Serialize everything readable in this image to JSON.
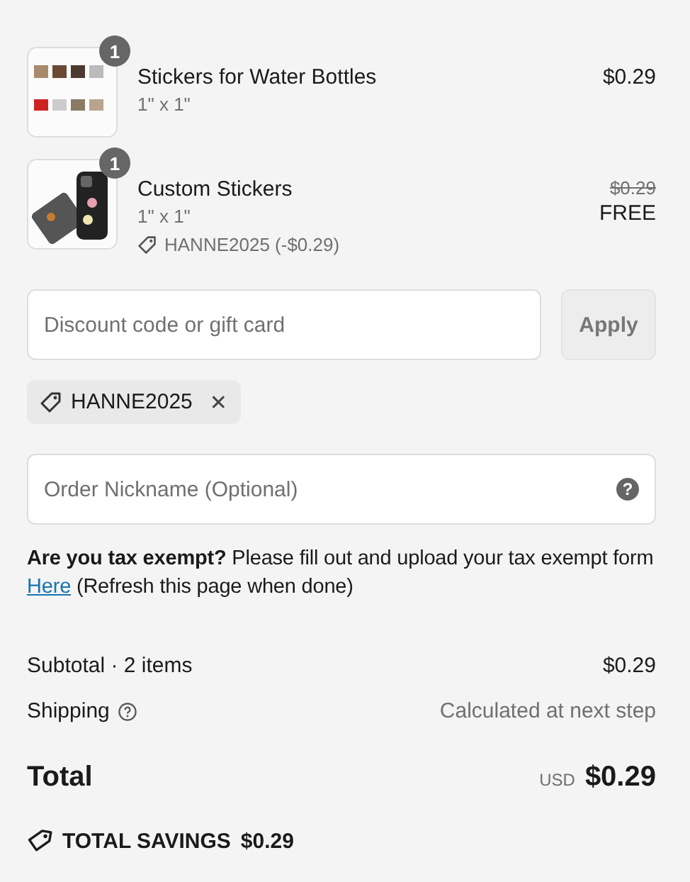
{
  "line_items": [
    {
      "quantity": "1",
      "name": "Stickers for Water Bottles",
      "variant": "1\" x 1\"",
      "price": "$0.29"
    },
    {
      "quantity": "1",
      "name": "Custom Stickers",
      "variant": "1\" x 1\"",
      "discount": "HANNE2025 (-$0.29)",
      "original_price": "$0.29",
      "price": "FREE"
    }
  ],
  "discount_field": {
    "placeholder": "Discount code or gift card"
  },
  "apply_button": {
    "label": "Apply",
    "disabled": true
  },
  "applied_codes": [
    {
      "code": "HANNE2025",
      "remove": "✕"
    }
  ],
  "nickname_field": {
    "placeholder": "Order Nickname (Optional)",
    "help": "?"
  },
  "tax_note": {
    "text": "**Are you tax exempt?** Please fill out and upload your tax exempt form",
    "link": "Here",
    "after": "(Refresh this page when done)"
  },
  "summary": [
    {
      "label": "Subtotal · 2 items",
      "value": "$0.29",
      "muted": false,
      "help": false
    },
    {
      "label": "Shipping",
      "value": "Calculated at next step",
      "muted": true,
      "help": true
    }
  ],
  "total": {
    "label": "Total",
    "currency": "USD",
    "amount": "$0.29"
  },
  "savings": {
    "label": "TOTAL SAVINGS",
    "amount": "$0.29"
  }
}
